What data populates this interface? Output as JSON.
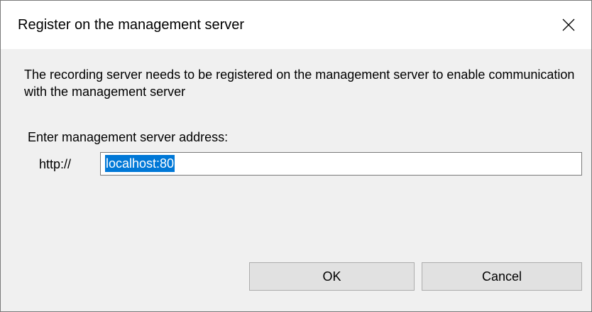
{
  "dialog": {
    "title": "Register on the management server",
    "close_icon": "close-icon",
    "description": "The recording server needs to be registered on the management server to enable communication with the management server",
    "address_label": "Enter management server address:",
    "protocol_prefix": "http://",
    "address_value": "localhost:80",
    "ok_label": "OK",
    "cancel_label": "Cancel"
  },
  "colors": {
    "selection": "#0078d7",
    "dialog_background": "#f0f0f0",
    "titlebar_background": "#ffffff",
    "button_background": "#e1e1e1"
  }
}
